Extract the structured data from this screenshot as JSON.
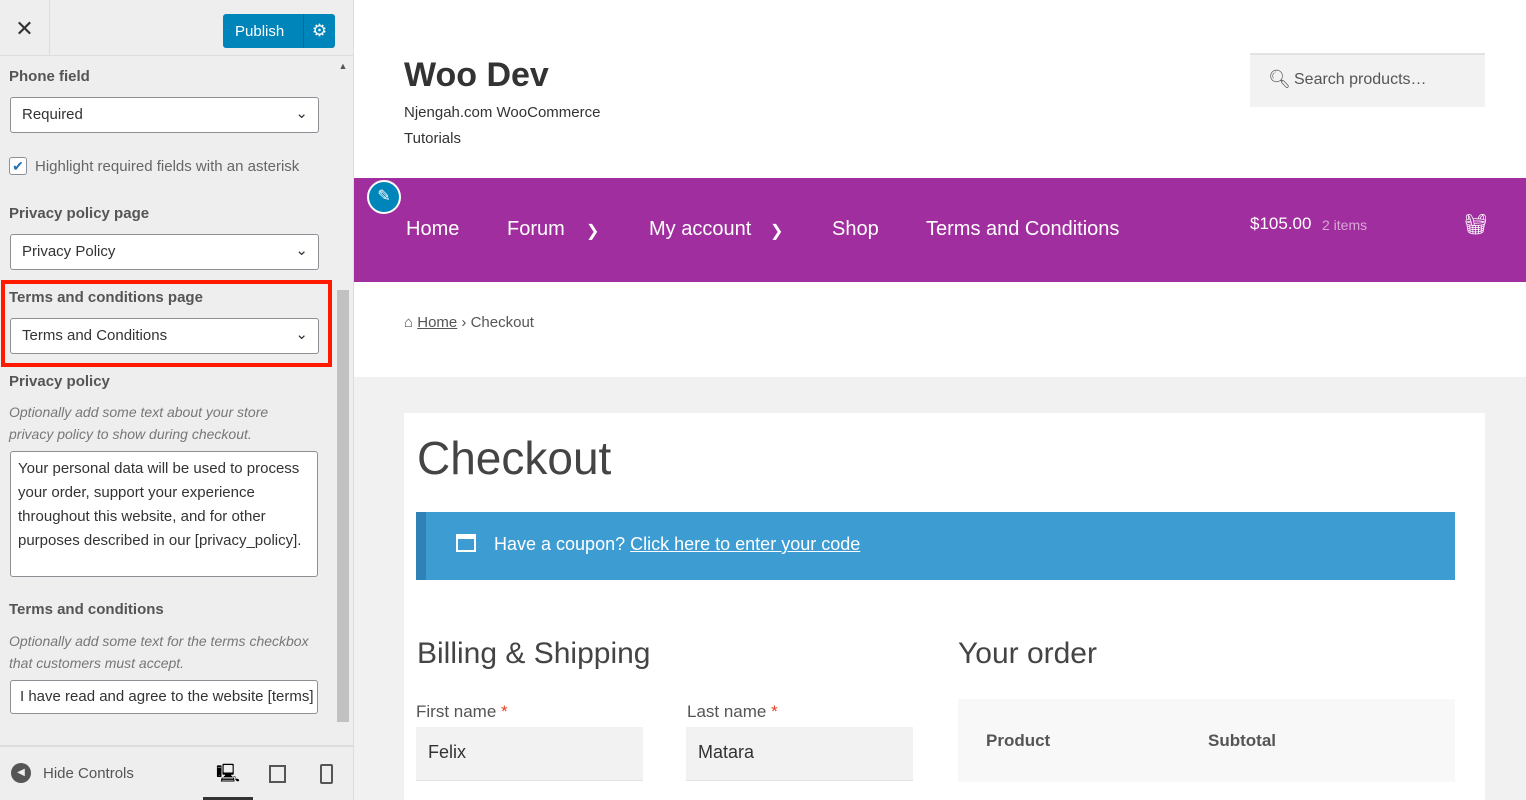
{
  "customizer": {
    "close": "✕",
    "publish": "Publish",
    "phone_field": {
      "label": "Phone field",
      "value": "Required"
    },
    "highlight_required": {
      "label": "Highlight required fields with an asterisk",
      "checked": true
    },
    "privacy_page": {
      "label": "Privacy policy page",
      "value": "Privacy Policy"
    },
    "terms_page": {
      "label": "Terms and conditions page",
      "value": "Terms and Conditions"
    },
    "privacy_policy": {
      "label": "Privacy policy",
      "description": "Optionally add some text about your store privacy policy to show during checkout.",
      "value": "Your personal data will be used to process your order, support your experience throughout this website, and for other purposes described in our [privacy_policy]."
    },
    "terms": {
      "label": "Terms and conditions",
      "description": "Optionally add some text for the terms checkbox that customers must accept.",
      "value": "I have read and agree to the website [terms]"
    },
    "hide_controls": "Hide Controls"
  },
  "site": {
    "title": "Woo Dev",
    "tagline": "Njengah.com WooCommerce Tutorials",
    "search_placeholder": "Search products…",
    "nav": [
      "Home",
      "Forum",
      "My account",
      "Shop",
      "Terms and Conditions"
    ],
    "cart_total": "$105.00",
    "cart_items": "2 items",
    "breadcrumb": {
      "home": "Home",
      "current": "Checkout"
    },
    "page_title": "Checkout",
    "coupon": {
      "text": "Have a coupon?",
      "link": "Click here to enter your code"
    },
    "billing_title": "Billing & Shipping",
    "order_title": "Your order",
    "first_name": {
      "label": "First name",
      "value": "Felix"
    },
    "last_name": {
      "label": "Last name",
      "value": "Matara"
    },
    "order_cols": [
      "Product",
      "Subtotal"
    ],
    "colors": {
      "nav": "#a02e9e",
      "coupon": "#3d9cd2",
      "publish": "#0085ba",
      "highlight": "#ff1a00"
    }
  }
}
